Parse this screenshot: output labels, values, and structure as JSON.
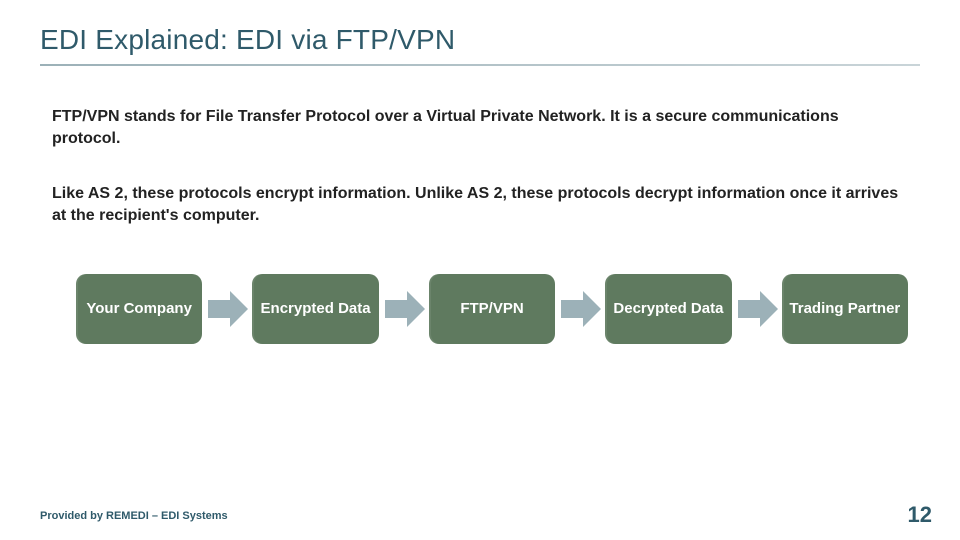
{
  "title": "EDI Explained: EDI via FTP/VPN",
  "paragraphs": {
    "p1": "FTP/VPN stands for File Transfer Protocol over a Virtual Private Network. It is a secure communications protocol.",
    "p2": "Like AS 2, these protocols encrypt information. Unlike AS 2, these protocols decrypt information once it arrives at the recipient's computer."
  },
  "flow": {
    "n1": "Your Company",
    "n2": "Encrypted Data",
    "n3": "FTP/VPN",
    "n4": "Decrypted Data",
    "n5": "Trading Partner"
  },
  "footer": "Provided by REMEDI – EDI Systems",
  "page_number": "12",
  "colors": {
    "title": "#2f5a6a",
    "node_bg": "#5f7a5f",
    "arrow": "#9cb1b8"
  }
}
